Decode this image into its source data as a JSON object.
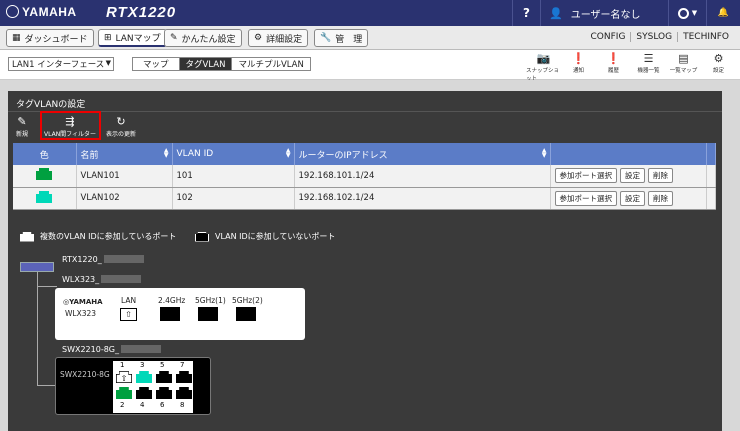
{
  "topbar": {
    "brand": "YAMAHA",
    "model": "RTX1220",
    "help": "?",
    "user": "ユーザー名なし"
  },
  "nav": {
    "tabs": [
      {
        "label": "ダッシュボード",
        "icon": "dashboard-icon"
      },
      {
        "label": "LANマップ",
        "icon": "lanmap-icon"
      },
      {
        "label": "かんたん設定",
        "icon": "wizard-icon"
      },
      {
        "label": "詳細設定",
        "icon": "gear-icon"
      },
      {
        "label": "管　理",
        "icon": "wrench-icon"
      }
    ],
    "links": [
      "CONFIG",
      "SYSLOG",
      "TECHINFO"
    ]
  },
  "toolbar": {
    "interface": "LAN1 インターフェース",
    "view_tabs": [
      "マップ",
      "タグVLAN",
      "マルチプルVLAN"
    ],
    "tools": [
      {
        "label": "スナップショット",
        "icon": "camera-icon"
      },
      {
        "label": "通知",
        "icon": "alert-icon"
      },
      {
        "label": "履歴",
        "icon": "history-icon"
      },
      {
        "label": "機器一覧",
        "icon": "list-icon"
      },
      {
        "label": "一覧マップ",
        "icon": "map-icon"
      },
      {
        "label": "設定",
        "icon": "settings-icon"
      }
    ]
  },
  "panel": {
    "title": "タグVLANの設定",
    "actions": [
      {
        "label": "新規",
        "icon": "new-icon"
      },
      {
        "label": "VLAN間フィルター",
        "icon": "filter-icon"
      },
      {
        "label": "表示の更新",
        "icon": "refresh-icon"
      }
    ]
  },
  "table": {
    "headers": [
      "色",
      "名前",
      "VLAN ID",
      "ルーターのIPアドレス",
      ""
    ],
    "rows": [
      {
        "color": "#00a040",
        "name": "VLAN101",
        "id": "101",
        "ip": "192.168.101.1/24"
      },
      {
        "color": "#00d8b8",
        "name": "VLAN102",
        "id": "102",
        "ip": "192.168.102.1/24"
      }
    ],
    "buttons": [
      "参加ポート選択",
      "設定",
      "削除"
    ]
  },
  "legend": {
    "multi": "複数のVLAN IDに参加しているポート",
    "none": "VLAN IDに参加していないポート"
  },
  "devices": {
    "router": "RTX1220_",
    "wlx_name": "WLX323_",
    "wlx_brand": "YAMAHA",
    "wlx_model": "WLX323",
    "wlx_ports": [
      "LAN",
      "2.4GHz",
      "5GHz(1)",
      "5GHz(2)"
    ],
    "swx_name": "SWX2210-8G_",
    "swx_model": "SWX2210-8G",
    "swx_port_numbers": [
      "1",
      "3",
      "5",
      "7",
      "2",
      "4",
      "6",
      "8"
    ]
  }
}
